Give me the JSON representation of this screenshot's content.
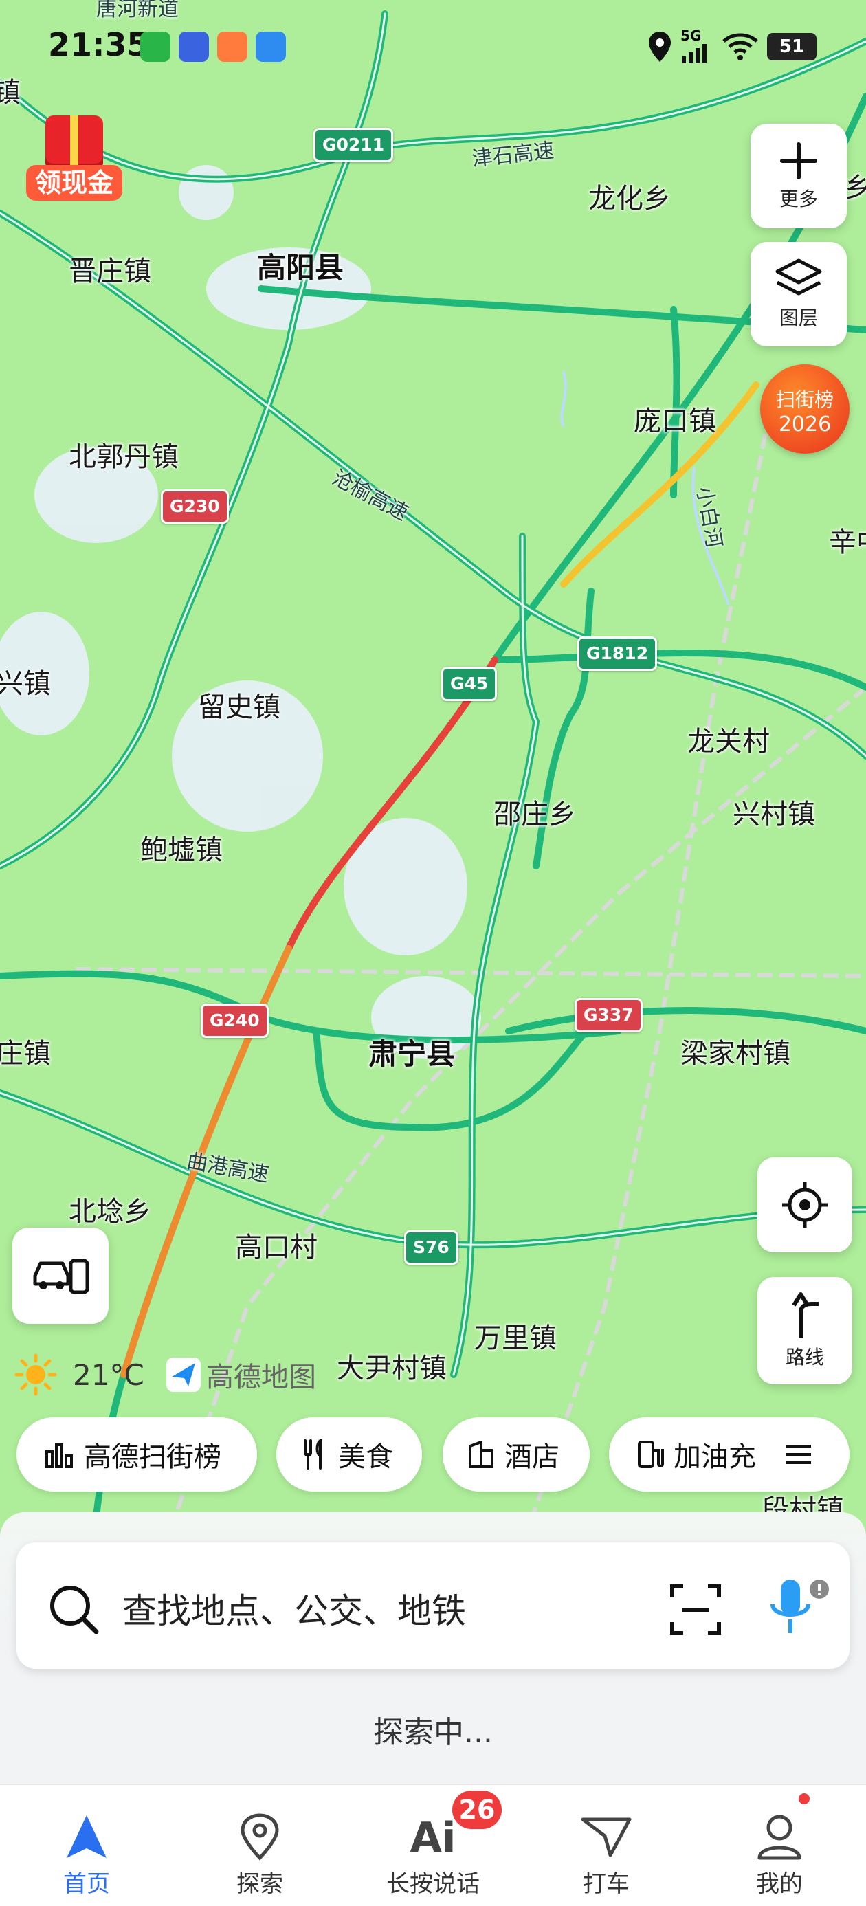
{
  "status_bar": {
    "time": "21:35",
    "network": "5G",
    "battery": "51"
  },
  "map": {
    "places": [
      {
        "id": "jinzhuang",
        "name": "晋庄镇"
      },
      {
        "id": "gaoyang",
        "name": "高阳县"
      },
      {
        "id": "longhua",
        "name": "龙化乡"
      },
      {
        "id": "pangkou",
        "name": "庞口镇"
      },
      {
        "id": "beiguodan",
        "name": "北郭丹镇"
      },
      {
        "id": "liushi",
        "name": "留史镇"
      },
      {
        "id": "baoxu",
        "name": "鲍墟镇"
      },
      {
        "id": "shaozhuang",
        "name": "邵庄乡"
      },
      {
        "id": "longguan",
        "name": "龙关村"
      },
      {
        "id": "xingcun",
        "name": "兴村镇"
      },
      {
        "id": "suning",
        "name": "肃宁县"
      },
      {
        "id": "liangjia",
        "name": "梁家村镇"
      },
      {
        "id": "beiqian",
        "name": "北埝乡"
      },
      {
        "id": "gaokou",
        "name": "高口村"
      },
      {
        "id": "wanli",
        "name": "万里镇"
      },
      {
        "id": "dayin",
        "name": "大尹村镇"
      },
      {
        "id": "duancun",
        "name": "段村镇"
      },
      {
        "id": "xin_edge",
        "name": "兴镇"
      },
      {
        "id": "zhuang_edge",
        "name": "庄镇"
      },
      {
        "id": "zhen_edge",
        "name": "镇"
      },
      {
        "id": "xin2_edge",
        "name": "辛中"
      },
      {
        "id": "xiang_edge",
        "name": "乡"
      }
    ],
    "shields": [
      {
        "id": "g0211",
        "label": "G0211",
        "color": "green"
      },
      {
        "id": "g230",
        "label": "G230",
        "color": "red"
      },
      {
        "id": "g45",
        "label": "G45",
        "color": "green"
      },
      {
        "id": "g1812",
        "label": "G1812",
        "color": "green"
      },
      {
        "id": "g240",
        "label": "G240",
        "color": "red"
      },
      {
        "id": "g337",
        "label": "G337",
        "color": "red"
      },
      {
        "id": "s76",
        "label": "S76",
        "color": "green"
      }
    ],
    "roads": [
      {
        "id": "jinshi",
        "name": "津石高速"
      },
      {
        "id": "cangyu",
        "name": "沧榆高速"
      },
      {
        "id": "qugang",
        "name": "曲港高速"
      },
      {
        "id": "tanghe",
        "name": "唐河新道"
      },
      {
        "id": "xiaobaihe",
        "name": "小白河"
      }
    ]
  },
  "promo": {
    "label": "领现金"
  },
  "controls": {
    "more_label": "更多",
    "layers_label": "图层",
    "saojie_line1": "扫街榜",
    "saojie_line2": "2026",
    "route_label": "路线"
  },
  "weather": {
    "temp": "21°C",
    "brand": "高德地图"
  },
  "chips": [
    {
      "label": "高德扫街榜",
      "icon": "ranking-icon"
    },
    {
      "label": "美食",
      "icon": "food-icon"
    },
    {
      "label": "酒店",
      "icon": "hotel-icon"
    },
    {
      "label": "加油充",
      "icon": "fuel-icon"
    }
  ],
  "search": {
    "placeholder": "查找地点、公交、地铁"
  },
  "explore_status": "探索中...",
  "nav": [
    {
      "label": "首页",
      "icon": "home-icon"
    },
    {
      "label": "探索",
      "icon": "explore-icon"
    },
    {
      "label": "长按说话",
      "icon": "ai-icon",
      "badge": "26"
    },
    {
      "label": "打车",
      "icon": "taxi-icon"
    },
    {
      "label": "我的",
      "icon": "profile-icon"
    }
  ],
  "colors": {
    "accent": "#2a6ff0",
    "map_bg": "#aeee9a",
    "road": "#1fb87a",
    "badge": "#ee3b3b"
  }
}
